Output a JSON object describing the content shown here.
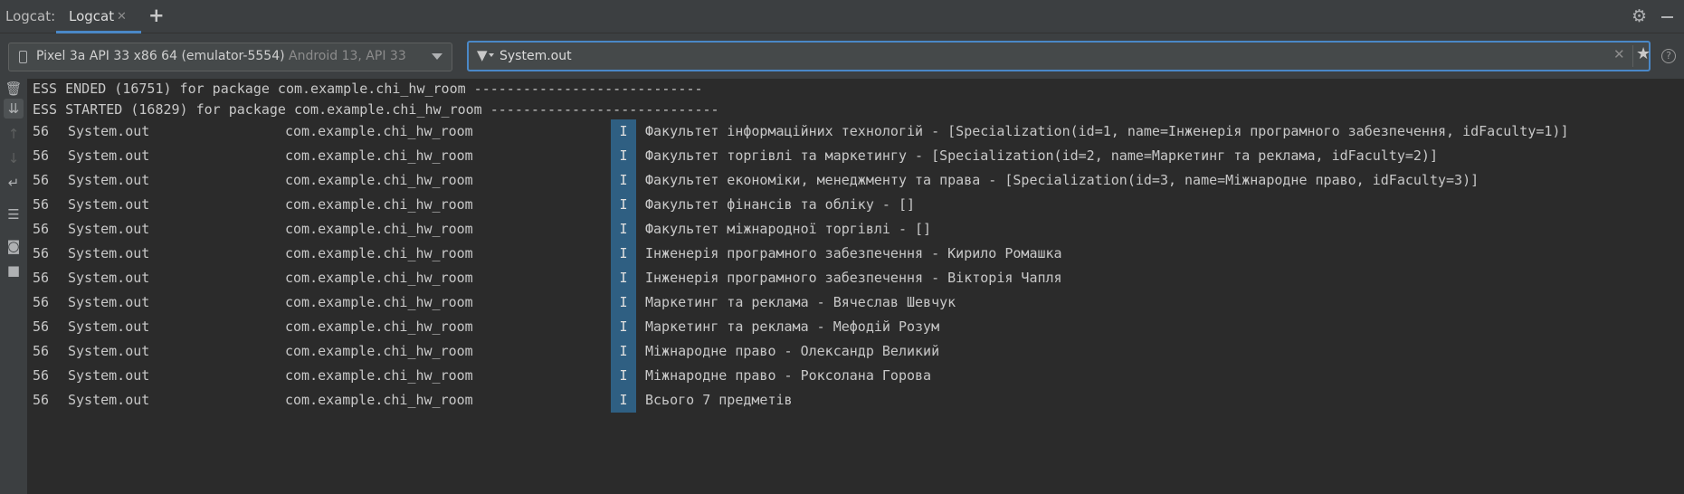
{
  "toolbar": {
    "title": "Logcat:",
    "tab_label": "Logcat",
    "close_glyph": "✕",
    "add_glyph": "+",
    "icons": {
      "tab_close": "close-icon",
      "add_tab": "plus-icon",
      "settings": "gear-icon",
      "hide": "minimize-icon"
    }
  },
  "device": {
    "name": "Pixel 3a API 33 x86 64 (emulator-5554)",
    "api": "Android 13, API 33",
    "icons": {
      "device": "phone-icon",
      "dropdown": "chevron-down-icon"
    }
  },
  "filter": {
    "value": "System.out",
    "icons": {
      "filter": "filter-icon",
      "clear": "close-icon",
      "favorite": "star-icon",
      "help": "help-icon"
    },
    "help_glyph": "?"
  },
  "sidebar": {
    "icons": [
      "trash-icon",
      "scroll-to-end-icon",
      "arrow-up-icon",
      "arrow-down-icon",
      "soft-wrap-icon",
      "settings-sliders-icon",
      "camera-icon",
      "video-icon"
    ]
  },
  "log": {
    "header_lines": [
      "ESS ENDED (16751) for package com.example.chi_hw_room ----------------------------",
      "ESS STARTED (16829) for package com.example.chi_hw_room ----------------------------"
    ],
    "rows": [
      {
        "pid": "56",
        "tag": "System.out",
        "package": "com.example.chi_hw_room",
        "level": "I",
        "message": "Факультет інформаційних технологій - [Specialization(id=1, name=Інженерія програмного забезпечення, idFaculty=1)]"
      },
      {
        "pid": "56",
        "tag": "System.out",
        "package": "com.example.chi_hw_room",
        "level": "I",
        "message": "Факультет торгівлі та маркетингу - [Specialization(id=2, name=Маркетинг та реклама, idFaculty=2)]"
      },
      {
        "pid": "56",
        "tag": "System.out",
        "package": "com.example.chi_hw_room",
        "level": "I",
        "message": "Факультет економіки, менеджменту та права - [Specialization(id=3, name=Міжнародне право, idFaculty=3)]"
      },
      {
        "pid": "56",
        "tag": "System.out",
        "package": "com.example.chi_hw_room",
        "level": "I",
        "message": "Факультет фінансів та обліку - []"
      },
      {
        "pid": "56",
        "tag": "System.out",
        "package": "com.example.chi_hw_room",
        "level": "I",
        "message": "Факультет міжнародної торгівлі - []"
      },
      {
        "pid": "56",
        "tag": "System.out",
        "package": "com.example.chi_hw_room",
        "level": "I",
        "message": "Інженерія програмного забезпечення - Кирило Ромашка"
      },
      {
        "pid": "56",
        "tag": "System.out",
        "package": "com.example.chi_hw_room",
        "level": "I",
        "message": "Інженерія програмного забезпечення - Вікторія Чапля"
      },
      {
        "pid": "56",
        "tag": "System.out",
        "package": "com.example.chi_hw_room",
        "level": "I",
        "message": "Маркетинг та реклама - Вячеслав Шевчук"
      },
      {
        "pid": "56",
        "tag": "System.out",
        "package": "com.example.chi_hw_room",
        "level": "I",
        "message": "Маркетинг та реклама - Мефодій Розум"
      },
      {
        "pid": "56",
        "tag": "System.out",
        "package": "com.example.chi_hw_room",
        "level": "I",
        "message": "Міжнародне право - Олександр Великий"
      },
      {
        "pid": "56",
        "tag": "System.out",
        "package": "com.example.chi_hw_room",
        "level": "I",
        "message": "Міжнародне право - Роксолана Горова"
      },
      {
        "pid": "56",
        "tag": "System.out",
        "package": "com.example.chi_hw_room",
        "level": "I",
        "message": "Всього 7 предметів"
      }
    ]
  },
  "colors": {
    "background": "#2b2b2b",
    "panel": "#3c3f41",
    "accent": "#4a88c7",
    "info_level": "#2f5f82"
  }
}
